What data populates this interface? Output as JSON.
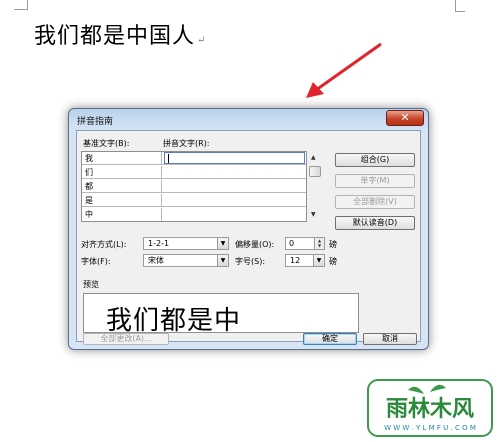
{
  "document": {
    "text": "我们都是中国人",
    "paragraph_mark": "↵"
  },
  "dialog": {
    "title": "拼音指南",
    "close_glyph": "✕",
    "labels": {
      "base_text": "基准文字(B):",
      "ruby_text": "拼音文字(R):",
      "alignment": "对齐方式(L):",
      "offset": "偏移量(O):",
      "font": "字体(F):",
      "size": "字号(S):",
      "preview": "预览",
      "unit_offset": "磅",
      "unit_size": "磅"
    },
    "rows": [
      {
        "base": "我",
        "ruby": ""
      },
      {
        "base": "们",
        "ruby": ""
      },
      {
        "base": "都",
        "ruby": ""
      },
      {
        "base": "是",
        "ruby": ""
      },
      {
        "base": "中",
        "ruby": ""
      }
    ],
    "buttons": {
      "group": "组合(G)",
      "single": "单字(M)",
      "clear_all": "全部删除(V)",
      "default_reading": "默认读音(D)",
      "change_all": "全部更改(A)...",
      "ok": "确定",
      "cancel": "取消"
    },
    "alignment_value": "1-2-1",
    "offset_value": "0",
    "font_value": "宋体",
    "size_value": "12",
    "preview_text": "我们都是中"
  },
  "watermark": {
    "brand": "雨林木风",
    "url": "W W W . Y L M F U . C O M"
  },
  "colors": {
    "arrow": "#e1242b",
    "logo_green": "#2a8a3a",
    "logo_teal": "#1b8aa8"
  }
}
